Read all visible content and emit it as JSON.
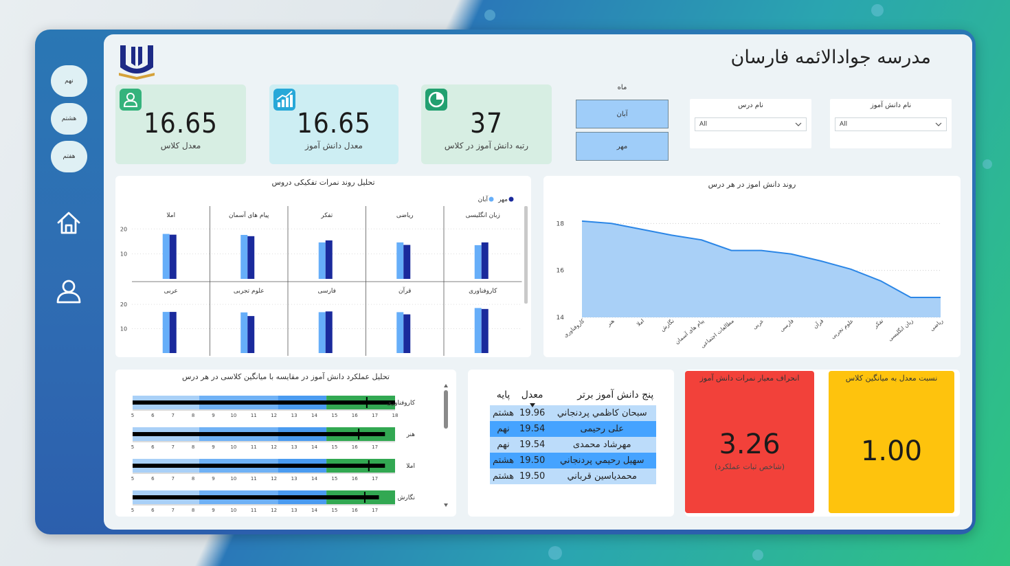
{
  "school": {
    "title": "مدرسه جوادالائمه فارسان"
  },
  "nav": {
    "grades": [
      "نهم",
      "هشتم",
      "هفتم"
    ]
  },
  "kpis": [
    {
      "value": "16.65",
      "label": "معدل کلاس",
      "bg": "#d7eee3",
      "icon_bg": "#34b37c",
      "icon": "user-icon"
    },
    {
      "value": "16.65",
      "label": "معدل دانش آموز",
      "bg": "#cdeef3",
      "icon_bg": "#27a8d8",
      "icon": "chart-up-icon"
    },
    {
      "value": "37",
      "label": "رتبه دانش آموز در کلاس",
      "bg": "#d7eee3",
      "icon_bg": "#22a070",
      "icon": "pie-icon"
    }
  ],
  "slicers": {
    "month": {
      "title": "ماه",
      "options": [
        "آبان",
        "مهر"
      ]
    },
    "lesson": {
      "title": "نام درس",
      "value": "All"
    },
    "student": {
      "title": "نام دانش آموز",
      "value": "All"
    }
  },
  "colors": {
    "aban": "#66aef9",
    "mehr": "#1a2a9c",
    "area_fill": "#a9d0f7",
    "area_line": "#2b86e6",
    "red": "#f2413a",
    "yellow": "#fec30d"
  },
  "chart_data": [
    {
      "type": "bar",
      "title": "تحلیل روند نمرات تفکیکی دروس",
      "legend": [
        "مهر",
        "آبان"
      ],
      "legend_position": "top-right",
      "y_ticks": [
        10,
        20
      ],
      "ylim": [
        0,
        22
      ],
      "panels": [
        {
          "name": "املا",
          "aban": 18.0,
          "mehr": 17.7
        },
        {
          "name": "پیام های آسمان",
          "aban": 17.6,
          "mehr": 17.1
        },
        {
          "name": "تفکر",
          "aban": 14.6,
          "mehr": 15.4
        },
        {
          "name": "ریاضی",
          "aban": 14.6,
          "mehr": 13.6
        },
        {
          "name": "زبان انگلیسی",
          "aban": 13.5,
          "mehr": 14.6
        },
        {
          "name": "عربی",
          "aban": 16.9,
          "mehr": 16.9
        },
        {
          "name": "علوم تجربی",
          "aban": 16.7,
          "mehr": 15.2
        },
        {
          "name": "فارسی",
          "aban": 16.8,
          "mehr": 17.1
        },
        {
          "name": "قرآن",
          "aban": 16.8,
          "mehr": 15.9
        },
        {
          "name": "کاروفناوری",
          "aban": 18.5,
          "mehr": 18.1
        }
      ]
    },
    {
      "type": "area",
      "title": "روند دانش اموز در هر درس",
      "y_ticks": [
        14,
        16,
        18
      ],
      "ylim": [
        14,
        18.8
      ],
      "categories": [
        "کاروفناوری",
        "هنر",
        "املا",
        "نگارش",
        "پیام های آسمان",
        "مطالعات اجتماعی",
        "عربی",
        "فارسی",
        "قرآن",
        "علوم تجربی",
        "تفکر",
        "زبان انگلیسی",
        "ریاضی"
      ],
      "values": [
        18.1,
        18.0,
        17.75,
        17.5,
        17.3,
        16.85,
        16.85,
        16.7,
        16.4,
        16.05,
        15.55,
        14.85,
        14.85
      ]
    },
    {
      "type": "bullet",
      "title": "تحلیل عملکرد دانش آموز در مقایسه با میانگین کلاسی در هر درس",
      "rows": [
        {
          "name": "کاروفناوری",
          "axis_min": 5,
          "axis_max": 18,
          "value": 18.0,
          "target": 16.6,
          "bands": [
            8.3,
            12.2,
            14.6,
            18.0
          ],
          "ticks": [
            5,
            6,
            7,
            8,
            9,
            10,
            11,
            12,
            13,
            14,
            15,
            16,
            17,
            18
          ]
        },
        {
          "name": "هنر",
          "axis_min": 5,
          "axis_max": 18,
          "value": 17.5,
          "target": 16.2,
          "bands": [
            8.3,
            12.2,
            14.6,
            18.0
          ],
          "ticks": [
            5,
            6,
            7,
            8,
            9,
            10,
            11,
            12,
            13,
            14,
            15,
            16,
            17
          ]
        },
        {
          "name": "املا",
          "axis_min": 5,
          "axis_max": 18,
          "value": 17.5,
          "target": 16.7,
          "bands": [
            8.3,
            12.2,
            14.6,
            18.0
          ],
          "ticks": [
            5,
            6,
            7,
            8,
            9,
            10,
            11,
            12,
            13,
            14,
            15,
            16,
            17
          ]
        },
        {
          "name": "نگارش",
          "axis_min": 5,
          "axis_max": 18,
          "value": 17.2,
          "target": 16.5,
          "bands": [
            8.3,
            12.2,
            14.6,
            18.0
          ],
          "ticks": [
            5,
            6,
            7,
            8,
            9,
            10,
            11,
            12,
            13,
            14,
            15,
            16,
            17
          ]
        }
      ]
    }
  ],
  "top_students": {
    "headers": {
      "name": "پنج دانش آموز برتر",
      "avg": "معدل",
      "grade": "پایه"
    },
    "rows": [
      {
        "name": "سبحان کاظمي پردنجاني",
        "avg": "19.96",
        "grade": "هشتم"
      },
      {
        "name": "على رحيمى",
        "avg": "19.54",
        "grade": "نهم"
      },
      {
        "name": "مهرشاد محمدی",
        "avg": "19.54",
        "grade": "نهم"
      },
      {
        "name": "سهيل رحيمي پردنجاني",
        "avg": "19.50",
        "grade": "هشتم"
      },
      {
        "name": "محمدياسين قرباني",
        "avg": "19.50",
        "grade": "هشتم"
      }
    ]
  },
  "cards": {
    "deviation": {
      "title": "انحراف معیار نمرات دانش آموز",
      "value": "3.26",
      "sub": "(شاخص ثبات عملکرد)"
    },
    "ratio": {
      "title": "نسبت معدل به میانگین کلاس",
      "value": "1.00"
    }
  }
}
